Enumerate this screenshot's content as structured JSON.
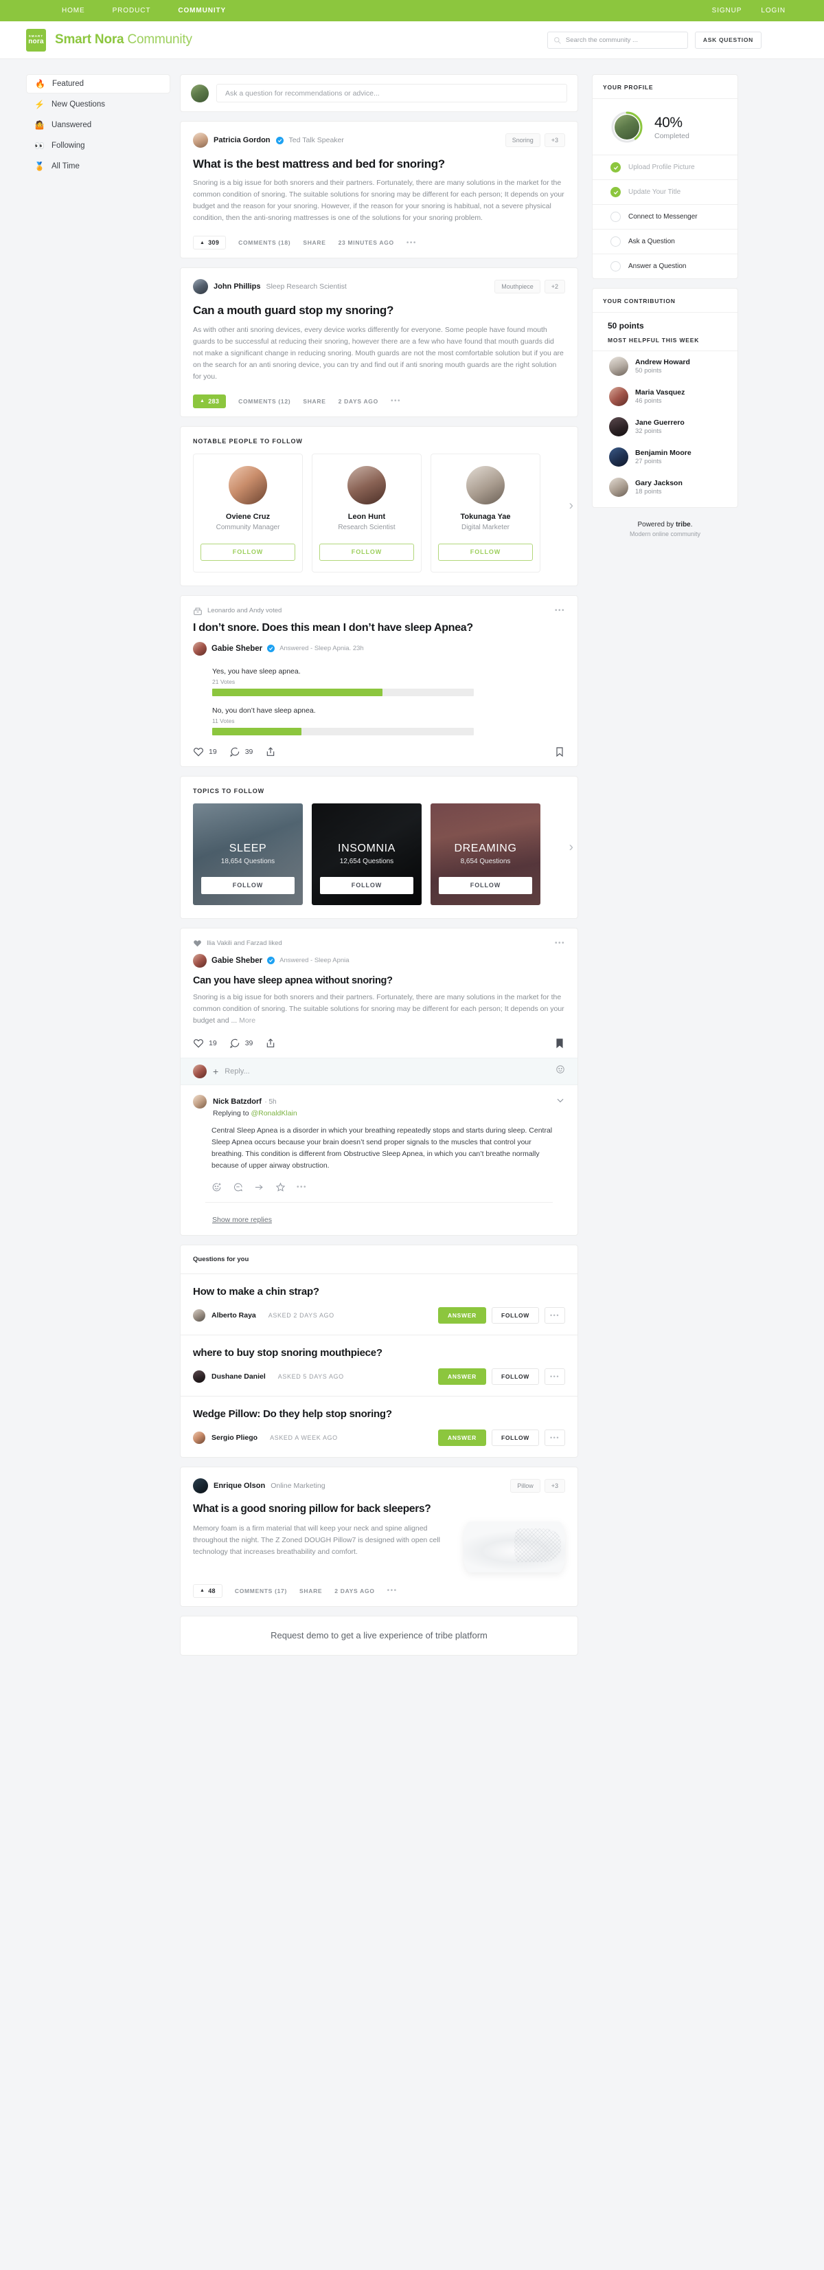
{
  "topnav": {
    "left": [
      {
        "label": "HOME",
        "active": false
      },
      {
        "label": "PRODUCT",
        "active": false
      },
      {
        "label": "COMMUNITY",
        "active": true
      }
    ],
    "right": [
      {
        "label": "SIGNUP"
      },
      {
        "label": "LOGIN"
      }
    ]
  },
  "header": {
    "logo_line1": "SMART",
    "logo_line2": "nora",
    "brand_bold": "Smart Nora",
    "brand_light": "Community",
    "search_placeholder": "Search the community ...",
    "ask_button": "ASK QUESTION",
    "accent": "#8cc63e"
  },
  "sidebar": {
    "items": [
      {
        "emoji": "🔥",
        "label": "Featured",
        "active": true
      },
      {
        "emoji": "⚡",
        "label": "New Questions",
        "active": false
      },
      {
        "emoji": "🤷",
        "label": "Uanswered",
        "active": false
      },
      {
        "emoji": "👀",
        "label": "Following",
        "active": false
      },
      {
        "emoji": "🏅",
        "label": "All Time",
        "active": false
      }
    ]
  },
  "composer": {
    "placeholder": "Ask a question for recommendations or advice..."
  },
  "posts": [
    {
      "author": "Patricia Gordon",
      "verified": true,
      "role": "Ted Talk Speaker",
      "tag": "Snoring",
      "tag_more": "+3",
      "title": "What is the best mattress and bed for snoring?",
      "body": "Snoring is a big issue for both snorers and their partners. Fortunately, there are many solutions in the market for the common condition of snoring. The suitable solutions for snoring may be different for each person; It depends on your budget and the reason for your snoring. However, if the reason for your snoring is habitual, not a severe physical condition, then the anti-snoring mattresses is one of the solutions for your snoring problem.",
      "votes": "309",
      "comments": "COMMENTS (18)",
      "share": "SHARE",
      "time": "23 MINUTES AGO",
      "vote_style": "plain"
    },
    {
      "author": "John Phillips",
      "verified": false,
      "role": "Sleep Research Scientist",
      "tag": "Mouthpiece",
      "tag_more": "+2",
      "title": "Can a mouth guard stop my snoring?",
      "body": "As with other anti snoring devices, every device works differently for everyone. Some people have found mouth guards to be successful at reducing their snoring, however there are a few who have found that mouth guards did not make a significant change in reducing snoring. Mouth guards are not the most comfortable solution but if you are on the search for an anti snoring device, you can try and find out if anti snoring mouth guards are the right solution for you.",
      "votes": "283",
      "comments": "COMMENTS (12)",
      "share": "SHARE",
      "time": "2 DAYS AGO",
      "vote_style": "green"
    }
  ],
  "people_section": {
    "title": "NOTABLE PEOPLE TO FOLLOW",
    "follow_label": "FOLLOW",
    "people": [
      {
        "name": "Oviene Cruz",
        "role": "Community Manager"
      },
      {
        "name": "Leon Hunt",
        "role": "Research Scientist"
      },
      {
        "name": "Tokunaga Yae",
        "role": "Digital Marketer"
      }
    ]
  },
  "poll_post": {
    "meta": "Leonardo and Andy voted",
    "title": "I don’t snore. Does this mean I don’t have sleep Apnea?",
    "author": "Gabie Sheber",
    "sub": "Answered - Sleep Apnia.   23h",
    "options": [
      {
        "label": "Yes, you have sleep apnea.",
        "votes": "21 Votes",
        "pct": 65
      },
      {
        "label": "No, you don’t have sleep apnea.",
        "votes": "11 Votes",
        "pct": 34
      }
    ],
    "likes": "19",
    "comments": "39"
  },
  "topics_section": {
    "title": "TOPICS TO FOLLOW",
    "follow_label": "FOLLOW",
    "topics": [
      {
        "name": "SLEEP",
        "questions": "18,654 Questions",
        "theme": "tp-sleep"
      },
      {
        "name": "INSOMNIA",
        "questions": "12,654 Questions",
        "theme": "tp-insom"
      },
      {
        "name": "DREAMING",
        "questions": "8,654 Questions",
        "theme": "tp-dream"
      }
    ]
  },
  "apnea_post": {
    "meta": "Ilia Vakili and Farzad liked",
    "author": "Gabie Sheber",
    "sub": "Answered - Sleep Apnia",
    "title": "Can you have sleep apnea without snoring?",
    "body": "Snoring is a big issue for both snorers and their partners. Fortunately, there are many solutions in the market for the common condition of snoring. The suitable solutions for snoring may be different for each person; It depends on your budget and ...",
    "more": "More",
    "likes": "19",
    "comments": "39",
    "reply_placeholder": "Reply...",
    "comment": {
      "name": "Nick Batzdorf",
      "time": "· 5h",
      "replying_prefix": "Replying to ",
      "replying_to": "@RonaldKlain",
      "body": "Central Sleep Apnea is a disorder in which your breathing repeatedly stops and starts during sleep. Central Sleep Apnea occurs because your brain doesn’t send proper signals to the muscles that control your breathing. This condition is different from Obstructive Sleep Apnea, in which you can’t breathe normally because of upper airway obstruction."
    },
    "show_more": "Show more replies"
  },
  "questions_for_you": {
    "title": "Questions for you",
    "answer_label": "ANSWER",
    "follow_label": "FOLLOW",
    "items": [
      {
        "title": "How to make a chin strap?",
        "author": "Alberto Raya",
        "asked": "ASKED 2 DAYS AGO"
      },
      {
        "title": "where to buy stop snoring mouthpiece?",
        "author": "Dushane Daniel",
        "asked": "ASKED 5 DAYS AGO"
      },
      {
        "title": "Wedge Pillow: Do they help stop snoring?",
        "author": "Sergio Pliego",
        "asked": "ASKED A WEEK AGO"
      }
    ]
  },
  "pillow_post": {
    "author": "Enrique Olson",
    "verified": true,
    "role": "Online Marketing",
    "tag": "Pillow",
    "tag_more": "+3",
    "title": "What is a good snoring pillow for back sleepers?",
    "body": "Memory foam is a firm material that will keep your neck and spine aligned throughout the night. The Z Zoned DOUGH Pillow7 is designed with open cell technology that increases breathability and comfort.",
    "votes": "48",
    "comments": "COMMENTS (17)",
    "share": "SHARE",
    "time": "2 DAYS AGO"
  },
  "demo_banner": {
    "text": "Request demo to get a live experience of tribe platform"
  },
  "profile": {
    "title": "YOUR PROFILE",
    "percent": "40%",
    "completed": "Completed",
    "progress_value": 40,
    "tasks": [
      {
        "label": "Upload Profile Picture",
        "done": true
      },
      {
        "label": "Update Your Title",
        "done": true
      },
      {
        "label": "Connect to Messenger",
        "done": false
      },
      {
        "label": "Ask a Question",
        "done": false
      },
      {
        "label": "Answer a Question",
        "done": false
      }
    ]
  },
  "contribution": {
    "title": "YOUR CONTRIBUTION",
    "points": "50 points",
    "most_helpful_title": "MOST HELPFUL THIS WEEK",
    "leaders": [
      {
        "name": "Andrew Howard",
        "points": "50 points"
      },
      {
        "name": "Maria Vasquez",
        "points": "46 points"
      },
      {
        "name": "Jane Guerrero",
        "points": "32 points"
      },
      {
        "name": "Benjamin Moore",
        "points": "27 points"
      },
      {
        "name": "Gary Jackson",
        "points": "18 points"
      }
    ]
  },
  "powered": {
    "prefix": "Powered by ",
    "brand": "tribe",
    "suffix": ".",
    "tagline": "Modern online community"
  }
}
